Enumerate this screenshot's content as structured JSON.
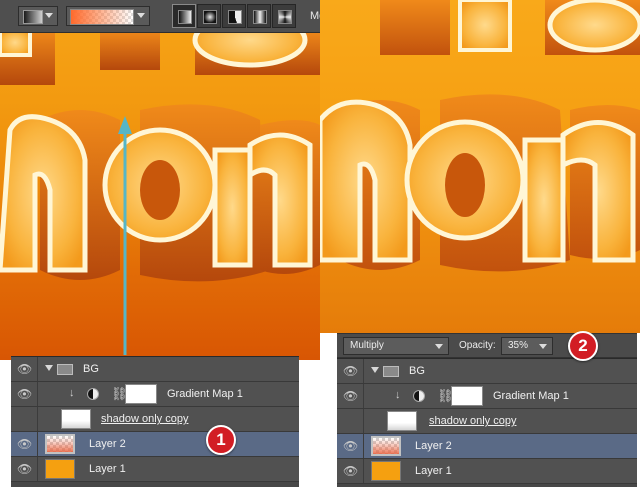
{
  "toolbar": {
    "truncated_label": "Mo",
    "gradient_mode_buttons": [
      "linear-gradient-icon",
      "radial-gradient-icon",
      "angle-gradient-icon",
      "reflected-gradient-icon",
      "diamond-gradient-icon"
    ]
  },
  "left_layers": [
    {
      "name": "BG",
      "type": "group"
    },
    {
      "name": "Gradient Map 1",
      "type": "adjustment"
    },
    {
      "name": "shadow only copy",
      "type": "layer"
    },
    {
      "name": "Layer 2",
      "type": "layer",
      "selected": true
    },
    {
      "name": "Layer 1",
      "type": "layer"
    }
  ],
  "right_layers": [
    {
      "name": "BG",
      "type": "group"
    },
    {
      "name": "Gradient Map 1",
      "type": "adjustment"
    },
    {
      "name": "shadow only copy",
      "type": "layer"
    },
    {
      "name": "Layer 2",
      "type": "layer",
      "selected": true
    },
    {
      "name": "Layer 1",
      "type": "layer"
    }
  ],
  "options_bar": {
    "blend_mode": "Multiply",
    "opacity_label": "Opacity:",
    "opacity_value": "35%"
  },
  "badges": {
    "step1": "1",
    "step2": "2"
  },
  "colors": {
    "badge": "#d21d24",
    "selected_row": "#5a6a86",
    "arrow": "#56b6c6"
  }
}
